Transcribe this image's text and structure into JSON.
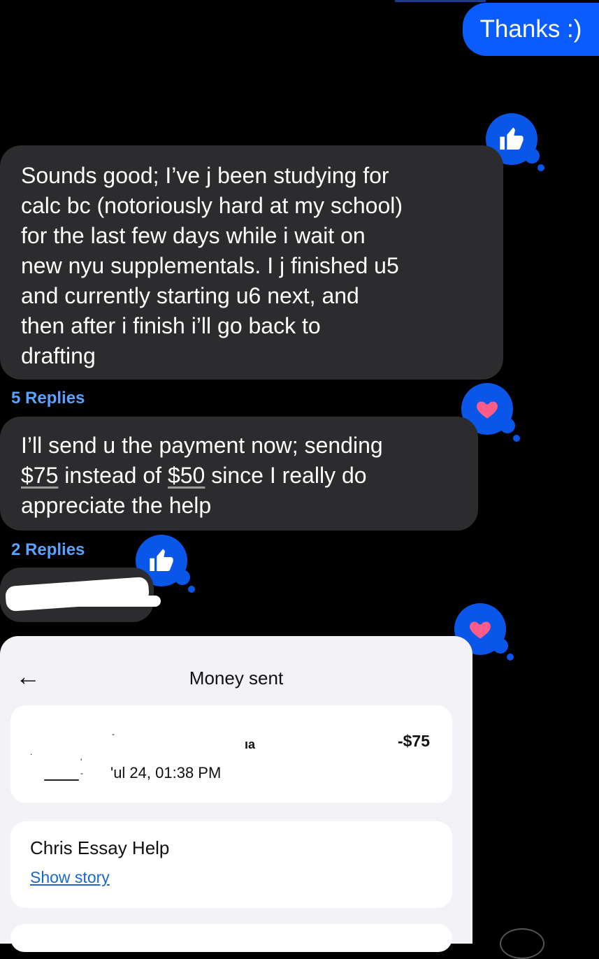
{
  "outgoing": {
    "text": "Thanks :)"
  },
  "messages": [
    {
      "lines": [
        "Sounds good; I’ve j been studying for",
        "calc bc (notoriously hard at my school)",
        "for the last few days while i wait on",
        "new nyu supplementals. I j finished u5",
        "and currently starting u6 next, and",
        "then after i finish i’ll go back to",
        "drafting"
      ],
      "replies": "5 Replies",
      "reaction": "thumbs-up-icon"
    },
    {
      "line1": "I’ll send u the payment now; sending",
      "price1": "$75",
      "mid": " instead of ",
      "price2": "$50",
      "tail": " since I really do",
      "line3": "appreciate the help",
      "replies": "2 Replies",
      "reaction": "heart-icon"
    }
  ],
  "screenshot": {
    "back": "←",
    "title": "Money sent",
    "transaction": {
      "date": "'ul 24, 01:38 PM",
      "amount": "-$75",
      "fragment": "ıa"
    },
    "story": {
      "title": "Chris Essay Help",
      "link": "Show story"
    }
  },
  "colors": {
    "outgoing_bubble": "#0a5cff",
    "incoming_bubble": "#2c2c2e",
    "reaction": "#0a56e8",
    "heart": "#ff5c8a",
    "replies_link": "#5aa2ff"
  }
}
